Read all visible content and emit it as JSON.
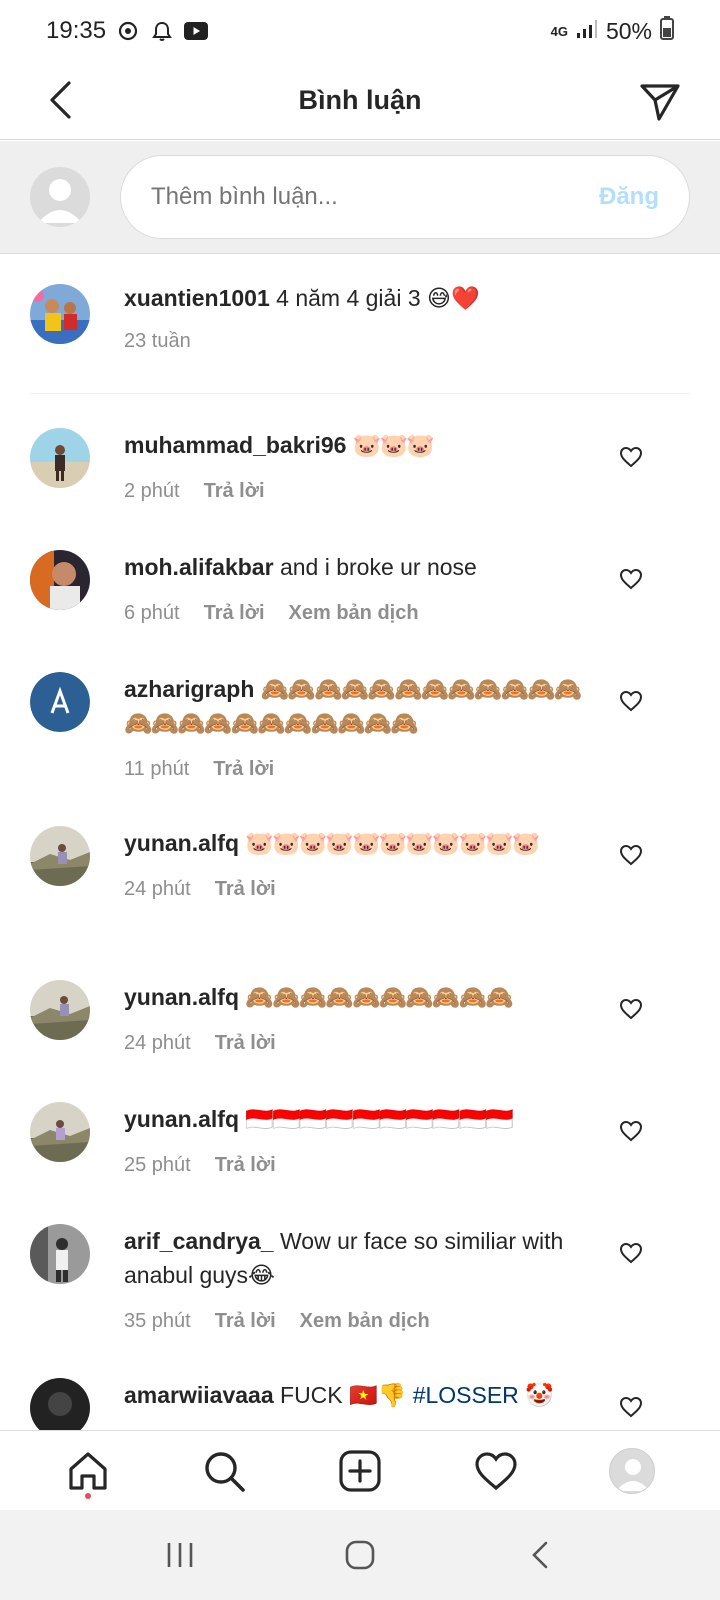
{
  "status_bar": {
    "time": "19:35",
    "network": "4G",
    "battery": "50%",
    "icons": [
      "sync-icon",
      "alarm-icon",
      "youtube-icon",
      "signal-icon",
      "battery-icon"
    ]
  },
  "header": {
    "title": "Bình luận",
    "back_icon": "back-arrow-icon",
    "share_icon": "send-icon"
  },
  "composer": {
    "placeholder": "Thêm bình luận...",
    "post_label": "Đăng"
  },
  "caption": {
    "username": "xuantien1001",
    "text": "4 năm 4 giải 3 😅❤️",
    "time": "23 tuần"
  },
  "comments": [
    {
      "username": "muhammad_bakri96",
      "text": "🐷🐷🐷",
      "time": "2 phút",
      "reply_label": "Trả lời",
      "translate_label": ""
    },
    {
      "username": "moh.alifakbar",
      "text": "and i broke ur nose",
      "time": "6 phút",
      "reply_label": "Trả lời",
      "translate_label": "Xem bản dịch"
    },
    {
      "username": "azharigraph",
      "text": "🙈🙈🙈🙈🙈🙈🙈🙈🙈🙈🙈🙈🙈🙈🙈🙈🙈🙈🙈🙈🙈🙈🙈",
      "time": "11 phút",
      "reply_label": "Trả lời",
      "translate_label": ""
    },
    {
      "username": "yunan.alfq",
      "text": "🐷🐷🐷🐷🐷🐷🐷🐷🐷🐷🐷",
      "time": "24 phút",
      "reply_label": "Trả lời",
      "translate_label": ""
    },
    {
      "username": "yunan.alfq",
      "text": "🙈🙈🙈🙈🙈🙈🙈🙈🙈🙈",
      "time": "24 phút",
      "reply_label": "Trả lời",
      "translate_label": ""
    },
    {
      "username": "yunan.alfq",
      "text": "🇮🇩🇮🇩🇮🇩🇮🇩🇮🇩🇮🇩🇮🇩🇮🇩🇮🇩🇮🇩",
      "time": "25 phút",
      "reply_label": "Trả lời",
      "translate_label": ""
    },
    {
      "username": "arif_candrya_",
      "text": "Wow ur face so similiar with anabul guys😂",
      "time": "35 phút",
      "reply_label": "Trả lời",
      "translate_label": "Xem bản dịch"
    },
    {
      "username": "amarwiiavaaa",
      "text": "FUCK 🇻🇳👎",
      "hashtag": "#LOSSER",
      "trailing_emoji": "🤡",
      "time": "",
      "reply_label": "",
      "translate_label": ""
    }
  ],
  "bottom_nav": {
    "items": [
      "home-icon",
      "search-icon",
      "create-post-icon",
      "activity-heart-icon",
      "profile-avatar"
    ]
  },
  "system_nav": {
    "items": [
      "recent-apps-icon",
      "home-button-icon",
      "back-icon"
    ]
  },
  "colors": {
    "accent_disabled": "#b2dffc",
    "secondary_text": "#8e8e8e",
    "notification_dot": "#ed4956",
    "hashtag": "#00376b"
  }
}
